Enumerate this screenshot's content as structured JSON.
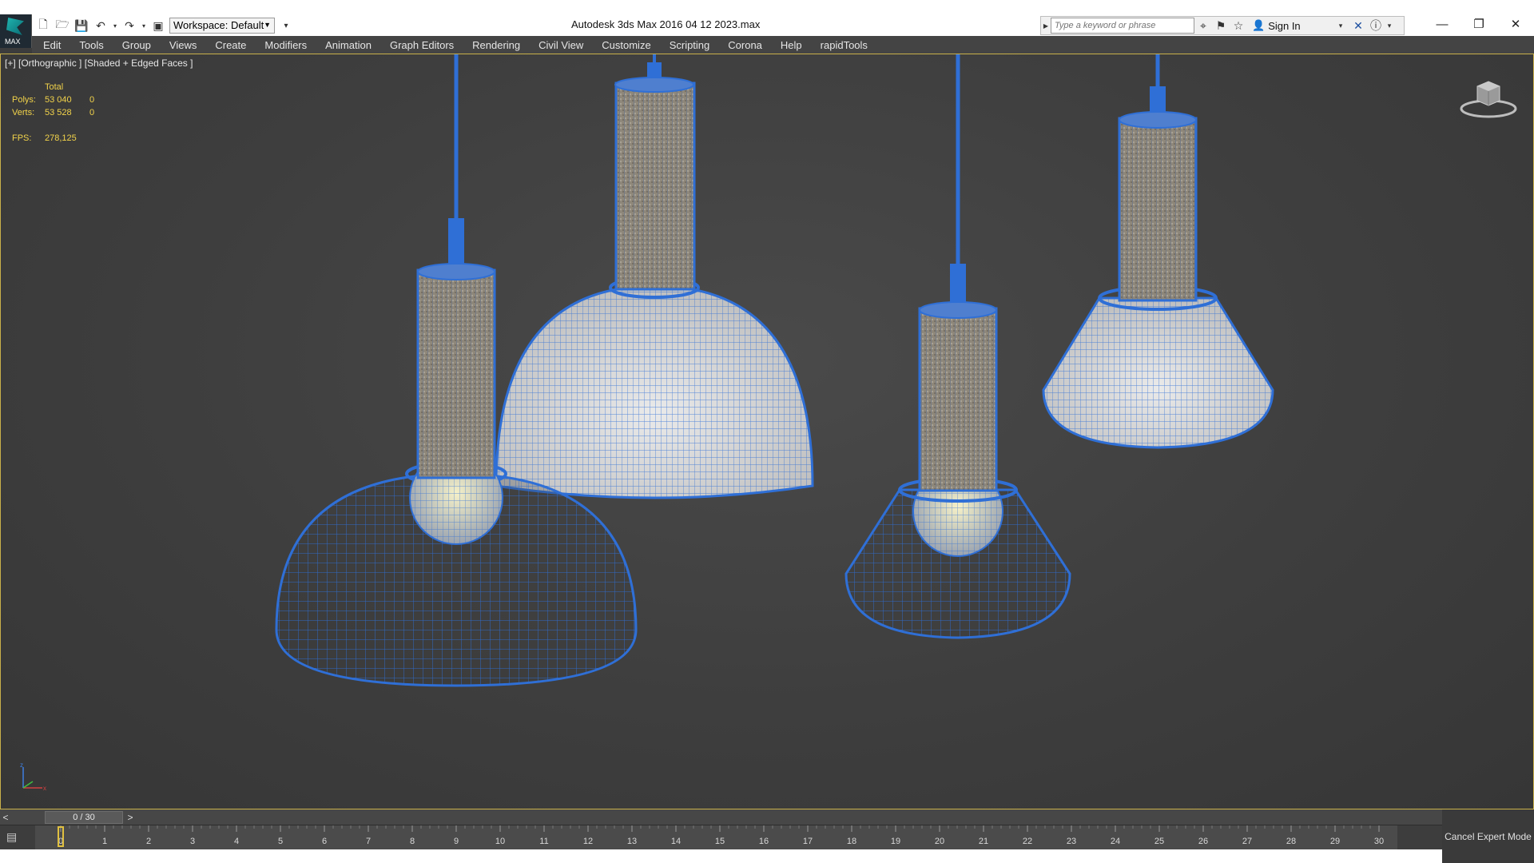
{
  "window": {
    "title": "Autodesk 3ds Max 2016     04 12 2023.max",
    "logo_label": "MAX",
    "workspace": "Workspace: Default"
  },
  "search": {
    "placeholder": "Type a keyword or phrase",
    "sign_in": "Sign In"
  },
  "menu": [
    "Edit",
    "Tools",
    "Group",
    "Views",
    "Create",
    "Modifiers",
    "Animation",
    "Graph Editors",
    "Rendering",
    "Civil View",
    "Customize",
    "Scripting",
    "Corona",
    "Help",
    "rapidTools"
  ],
  "viewport": {
    "label": "[+] [Orthographic ] [Shaded + Edged Faces ]",
    "stats": {
      "header": "Total",
      "polys_label": "Polys:",
      "polys_total": "53 040",
      "polys_sel": "0",
      "verts_label": "Verts:",
      "verts_total": "53 528",
      "verts_sel": "0",
      "fps_label": "FPS:",
      "fps_value": "278,125"
    },
    "wire_color": "#2f6fd6",
    "bg_color": "#3e3e3e"
  },
  "timeline": {
    "prev": "<",
    "next": ">",
    "slider": "0 / 30",
    "ticks": [
      "0",
      "1",
      "2",
      "3",
      "4",
      "5",
      "6",
      "7",
      "8",
      "9",
      "10",
      "11",
      "12",
      "13",
      "14",
      "15",
      "16",
      "17",
      "18",
      "19",
      "20",
      "21",
      "22",
      "23",
      "24",
      "25",
      "26",
      "27",
      "28",
      "29",
      "30"
    ],
    "current_frame": 0
  },
  "status": {
    "cancel_expert": "Cancel Expert Mode"
  },
  "icons": {
    "new": "new-file-icon",
    "open": "open-file-icon",
    "save": "save-icon",
    "undo": "undo-icon",
    "redo": "redo-icon",
    "project": "project-folder-icon"
  }
}
